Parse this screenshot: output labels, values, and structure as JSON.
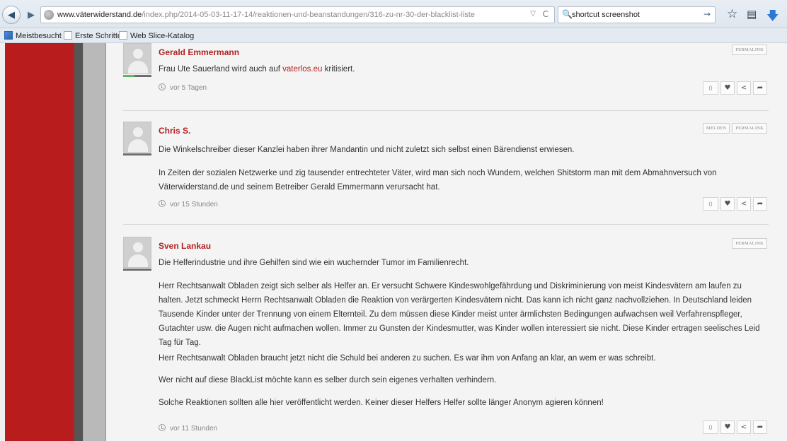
{
  "browser": {
    "nav": {
      "back_icon": "back-arrow-icon",
      "forward_icon": "forward-arrow-icon",
      "url_host": "www.väterwiderstand.de",
      "url_path": "/index.php/2014-05-03-11-17-14/reaktionen-und-beanstandungen/316-zu-nr-30-der-blacklist-liste",
      "url_dropdown_glyph": "▽",
      "reload_glyph": "C",
      "search_value": "shortcut screenshot",
      "search_go_glyph": "→"
    },
    "toolbar_icons": [
      "star-icon",
      "reading-list-icon",
      "download-icon"
    ],
    "bookmarks": [
      "Meistbesucht",
      "Erste Schritte",
      "Web Slice-Katalog"
    ]
  },
  "comments": [
    {
      "author": "Gerald Emmermann",
      "badges": [
        "PERMALINK"
      ],
      "paragraphs": [],
      "first_text_before": "Frau Ute Sauerland wird auch auf ",
      "first_link": "vaterlos.eu",
      "first_text_after": " kritisiert.",
      "time": "vor 5 Tagen",
      "votes": "0",
      "rank_fill": 0.4
    },
    {
      "author": "Chris S.",
      "badges": [
        "MELDEN",
        "PERMALINK"
      ],
      "paragraphs": [
        "Die Winkelschreiber dieser Kanzlei haben ihrer Mandantin und nicht zuletzt sich selbst einen Bärendienst erwiesen.",
        "In Zeiten der sozialen Netzwerke und zig tausender entrechteter Väter, wird man sich noch Wundern, welchen Shitstorm man mit dem Abmahnversuch von Väterwiderstand.de und seinem Betreiber Gerald Emmermann verursacht hat."
      ],
      "time": "vor 15 Stunden",
      "votes": "0",
      "rank_fill": 0
    },
    {
      "author": "Sven Lankau",
      "badges": [
        "PERMALINK"
      ],
      "paragraphs": [
        "Die Helferindustrie und ihre Gehilfen sind wie ein wuchernder Tumor im Familienrecht.",
        "Herr Rechtsanwalt Obladen zeigt sich selber als Helfer an. Er versucht Schwere Kindeswohlgefährdung und Diskriminierung von meist Kindesvätern am laufen zu halten. Jetzt schmeckt Herrn Rechtsanwalt Obladen die Reaktion von verärgerten Kindesvätern nicht. Das kann ich nicht ganz nachvollziehen. In Deutschland leiden Tausende Kinder unter der Trennung von einem Elternteil. Zu dem müssen diese Kinder meist unter ärmlichsten Bedingungen aufwachsen weil Verfahrenspfleger, Gutachter usw. die Augen nicht aufmachen wollen. Immer zu Gunsten der Kindesmutter, was Kinder wollen interessiert sie nicht. Diese Kinder ertragen seelisches Leid Tag für Tag.",
        "Herr Rechtsanwalt Obladen braucht jetzt nicht die Schuld bei anderen zu suchen. Es war ihm von Anfang an klar, an wem er was schreibt.",
        "Wer nicht auf diese BlackList möchte kann es selber durch sein eigenes verhalten verhindern.",
        "Solche Reaktionen sollten alle hier veröffentlicht werden. Keiner dieser Helfers Helfer sollte länger Anonym agieren können!"
      ],
      "time": "vor 11 Stunden",
      "votes": "0",
      "rank_fill": 0
    }
  ],
  "action_icons": [
    "heart-icon",
    "share-icon",
    "reply-arrow-icon"
  ],
  "colors": {
    "accent_red": "#b22222",
    "sidebar_red": "#b91c1c",
    "page_bg": "#f4f4f4"
  }
}
